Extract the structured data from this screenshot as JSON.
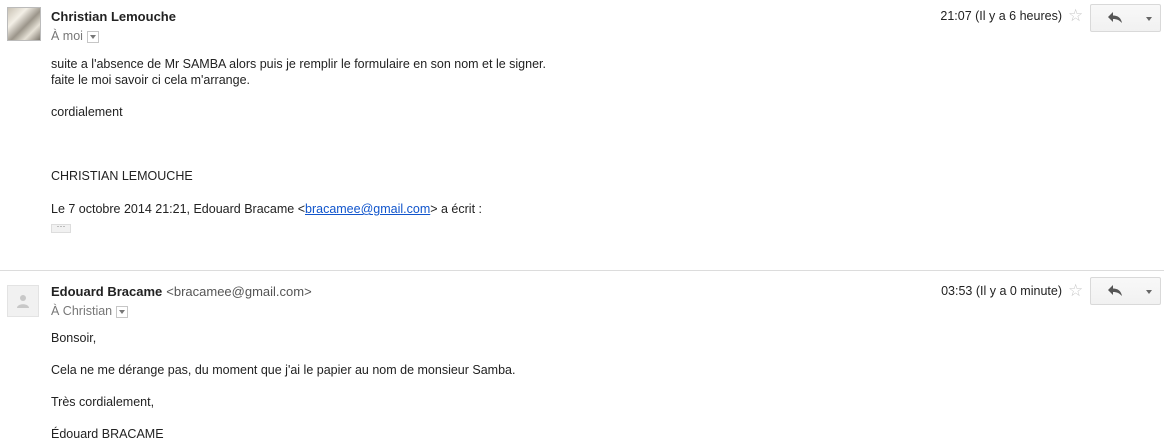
{
  "messages": [
    {
      "sender_name": "Christian Lemouche",
      "recipient": "À moi",
      "time": "21:07 (Il y a 6 heures)",
      "body": {
        "line1": "suite a l'absence de Mr SAMBA alors puis je remplir le formulaire en son nom et le signer.",
        "line2": "faite le moi savoir ci cela m'arrange.",
        "line3": "cordialement",
        "line4": "CHRISTIAN LEMOUCHE",
        "quote_prefix": "Le 7 octobre 2014 21:21, Edouard Bracame <",
        "quote_email": "bracamee@gmail.com",
        "quote_suffix": "> a écrit :"
      },
      "show_trimmed_label": "···"
    },
    {
      "sender_name": "Edouard Bracame",
      "sender_email": "<bracamee@gmail.com>",
      "recipient": "À Christian",
      "time": "03:53 (Il y a 0 minute)",
      "body": {
        "line1": "Bonsoir,",
        "line2": "Cela ne me dérange pas, du moment que j'ai le papier au nom de monsieur Samba.",
        "line3": "Très cordialement,",
        "line4": "Édouard BRACAME"
      }
    }
  ],
  "icons": {
    "star": "star-icon",
    "reply": "reply-icon",
    "more": "chevron-down-icon",
    "avatar_default": "person-icon"
  },
  "colors": {
    "link": "#1155cc",
    "star": "#c8c8c8"
  }
}
